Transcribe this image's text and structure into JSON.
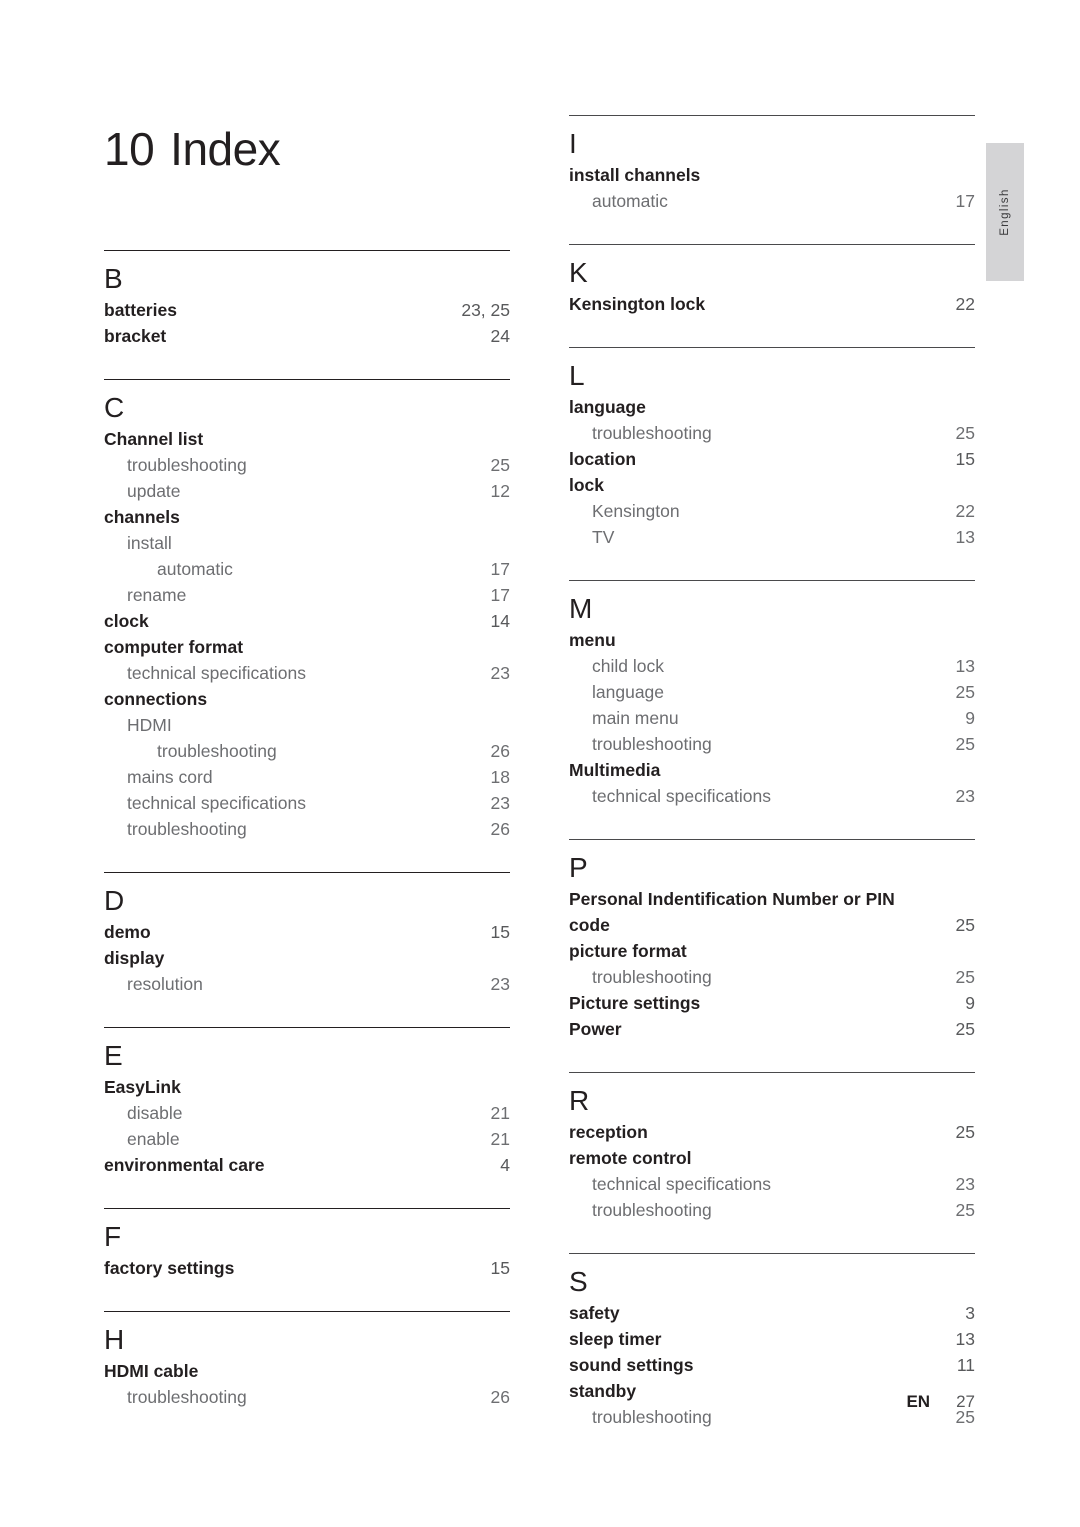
{
  "document": {
    "title_number": "10",
    "title_text": "Index",
    "side_tab_label": "English"
  },
  "footer": {
    "locale": "EN",
    "page_number": "27"
  },
  "left_column": [
    {
      "letter": "B",
      "entries": [
        {
          "label": "batteries",
          "page": "23, 25",
          "level": 0
        },
        {
          "label": "bracket",
          "page": "24",
          "level": 0
        }
      ]
    },
    {
      "letter": "C",
      "entries": [
        {
          "label": "Channel list",
          "page": "",
          "level": 0
        },
        {
          "label": "troubleshooting",
          "page": "25",
          "level": 1
        },
        {
          "label": "update",
          "page": "12",
          "level": 1
        },
        {
          "label": "channels",
          "page": "",
          "level": 0
        },
        {
          "label": "install",
          "page": "",
          "level": 1
        },
        {
          "label": "automatic",
          "page": "17",
          "level": 2
        },
        {
          "label": "rename",
          "page": "17",
          "level": 1
        },
        {
          "label": "clock",
          "page": "14",
          "level": 0
        },
        {
          "label": "computer format",
          "page": "",
          "level": 0
        },
        {
          "label": "technical specifications",
          "page": "23",
          "level": 1
        },
        {
          "label": "connections",
          "page": "",
          "level": 0
        },
        {
          "label": "HDMI",
          "page": "",
          "level": 1
        },
        {
          "label": "troubleshooting",
          "page": "26",
          "level": 2
        },
        {
          "label": "mains cord",
          "page": "18",
          "level": 1
        },
        {
          "label": "technical specifications",
          "page": "23",
          "level": 1
        },
        {
          "label": "troubleshooting",
          "page": "26",
          "level": 1
        }
      ]
    },
    {
      "letter": "D",
      "entries": [
        {
          "label": "demo",
          "page": "15",
          "level": 0
        },
        {
          "label": "display",
          "page": "",
          "level": 0
        },
        {
          "label": "resolution",
          "page": "23",
          "level": 1
        }
      ]
    },
    {
      "letter": "E",
      "entries": [
        {
          "label": "EasyLink",
          "page": "",
          "level": 0
        },
        {
          "label": "disable",
          "page": "21",
          "level": 1
        },
        {
          "label": "enable",
          "page": "21",
          "level": 1
        },
        {
          "label": "environmental care",
          "page": "4",
          "level": 0
        }
      ]
    },
    {
      "letter": "F",
      "entries": [
        {
          "label": "factory settings",
          "page": "15",
          "level": 0
        }
      ]
    },
    {
      "letter": "H",
      "entries": [
        {
          "label": "HDMI cable",
          "page": "",
          "level": 0
        },
        {
          "label": "troubleshooting",
          "page": "26",
          "level": 1
        }
      ]
    }
  ],
  "right_column": [
    {
      "letter": "I",
      "entries": [
        {
          "label": "install channels",
          "page": "",
          "level": 0
        },
        {
          "label": "automatic",
          "page": "17",
          "level": 1
        }
      ]
    },
    {
      "letter": "K",
      "entries": [
        {
          "label": "Kensington lock",
          "page": "22",
          "level": 0
        }
      ]
    },
    {
      "letter": "L",
      "entries": [
        {
          "label": "language",
          "page": "",
          "level": 0
        },
        {
          "label": "troubleshooting",
          "page": "25",
          "level": 1
        },
        {
          "label": "location",
          "page": "15",
          "level": 0
        },
        {
          "label": "lock",
          "page": "",
          "level": 0
        },
        {
          "label": "Kensington",
          "page": "22",
          "level": 1
        },
        {
          "label": "TV",
          "page": "13",
          "level": 1
        }
      ]
    },
    {
      "letter": "M",
      "entries": [
        {
          "label": "menu",
          "page": "",
          "level": 0
        },
        {
          "label": "child lock",
          "page": "13",
          "level": 1
        },
        {
          "label": "language",
          "page": "25",
          "level": 1
        },
        {
          "label": "main menu",
          "page": "9",
          "level": 1
        },
        {
          "label": "troubleshooting",
          "page": "25",
          "level": 1
        },
        {
          "label": "Multimedia",
          "page": "",
          "level": 0
        },
        {
          "label": "technical specifications",
          "page": "23",
          "level": 1
        }
      ]
    },
    {
      "letter": "P",
      "entries": [
        {
          "label": "Personal Indentification Number or PIN",
          "label_tail": "code",
          "page": "25",
          "level": 0,
          "wrap": true
        },
        {
          "label": "picture format",
          "page": "",
          "level": 0
        },
        {
          "label": "troubleshooting",
          "page": "25",
          "level": 1
        },
        {
          "label": "Picture settings",
          "page": "9",
          "level": 0
        },
        {
          "label": "Power",
          "page": "25",
          "level": 0
        }
      ]
    },
    {
      "letter": "R",
      "entries": [
        {
          "label": "reception",
          "page": "25",
          "level": 0
        },
        {
          "label": "remote control",
          "page": "",
          "level": 0
        },
        {
          "label": "technical specifications",
          "page": "23",
          "level": 1
        },
        {
          "label": "troubleshooting",
          "page": "25",
          "level": 1
        }
      ]
    },
    {
      "letter": "S",
      "entries": [
        {
          "label": "safety",
          "page": "3",
          "level": 0
        },
        {
          "label": "sleep timer",
          "page": "13",
          "level": 0
        },
        {
          "label": "sound settings",
          "page": "11",
          "level": 0
        },
        {
          "label": "standby",
          "page": "",
          "level": 0
        },
        {
          "label": "troubleshooting",
          "page": "25",
          "level": 1
        }
      ]
    }
  ]
}
